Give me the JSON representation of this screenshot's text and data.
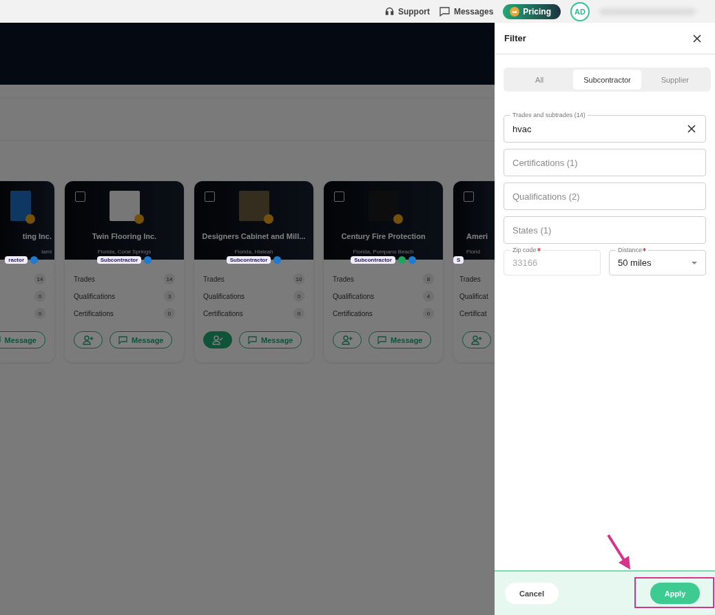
{
  "topbar": {
    "links": [
      {
        "kind": "support",
        "label": "Support"
      },
      {
        "kind": "messages",
        "label": "Messages"
      }
    ],
    "pricing": "Pricing",
    "avatar": "AD"
  },
  "cards": [
    {
      "kind": "partial_left",
      "name": "ting Inc.",
      "location": "iami",
      "type": "ractor",
      "verified": true,
      "approved": false,
      "stats": [
        {
          "count": "14"
        },
        {
          "count": "0"
        },
        {
          "count": "0"
        }
      ],
      "message": "Message"
    },
    {
      "kind": "full",
      "checked": false,
      "name": "Twin Flooring Inc.",
      "location": "Florida, Coral Springs",
      "type": "Subcontractor",
      "verified": true,
      "approved": false,
      "connected": false,
      "stats": [
        {
          "label": "Trades",
          "count": "14"
        },
        {
          "label": "Qualifications",
          "count": "3"
        },
        {
          "label": "Certifications",
          "count": "0"
        }
      ],
      "message": "Message"
    },
    {
      "kind": "full",
      "checked": false,
      "name": "Designers Cabinet and Mill...",
      "location": "Florida, Hialeah",
      "type": "Subcontractor",
      "verified": true,
      "approved": false,
      "connected": true,
      "stats": [
        {
          "label": "Trades",
          "count": "10"
        },
        {
          "label": "Qualifications",
          "count": "0"
        },
        {
          "label": "Certifications",
          "count": "0"
        }
      ],
      "message": "Message"
    },
    {
      "kind": "full",
      "checked": false,
      "name": "Century Fire Protection",
      "location": "Florida, Pompano Beach",
      "type": "Subcontractor",
      "verified": true,
      "approved": true,
      "connected": false,
      "stats": [
        {
          "label": "Trades",
          "count": "8"
        },
        {
          "label": "Qualifications",
          "count": "4"
        },
        {
          "label": "Certifications",
          "count": "0"
        }
      ],
      "message": "Message"
    },
    {
      "kind": "partial_right",
      "checked": false,
      "name": "Ameri",
      "location": "Florid",
      "type": "S",
      "connected": false,
      "stats": [
        {
          "label": "Trades"
        },
        {
          "label": "Qualificat"
        },
        {
          "label": "Certificat"
        }
      ]
    }
  ],
  "filter": {
    "title": "Filter",
    "tabs": [
      {
        "label": "All",
        "selected": false
      },
      {
        "label": "Subcontractor",
        "selected": true
      },
      {
        "label": "Supplier",
        "selected": false
      }
    ],
    "trades": {
      "label": "Trades and subtrades (14)",
      "value": "hvac"
    },
    "fields": [
      {
        "placeholder": "Certifications (1)"
      },
      {
        "placeholder": "Qualifications (2)"
      },
      {
        "placeholder": "States (1)"
      }
    ],
    "zip": {
      "label": "Zip code",
      "required": true,
      "value": "33166",
      "disabled": true
    },
    "distance": {
      "label": "Distance",
      "required": true,
      "value": "50 miles"
    },
    "cancel": "Cancel",
    "apply": "Apply"
  },
  "annotation": {
    "kind": "arrow_and_frame",
    "color": "#d6338a"
  }
}
